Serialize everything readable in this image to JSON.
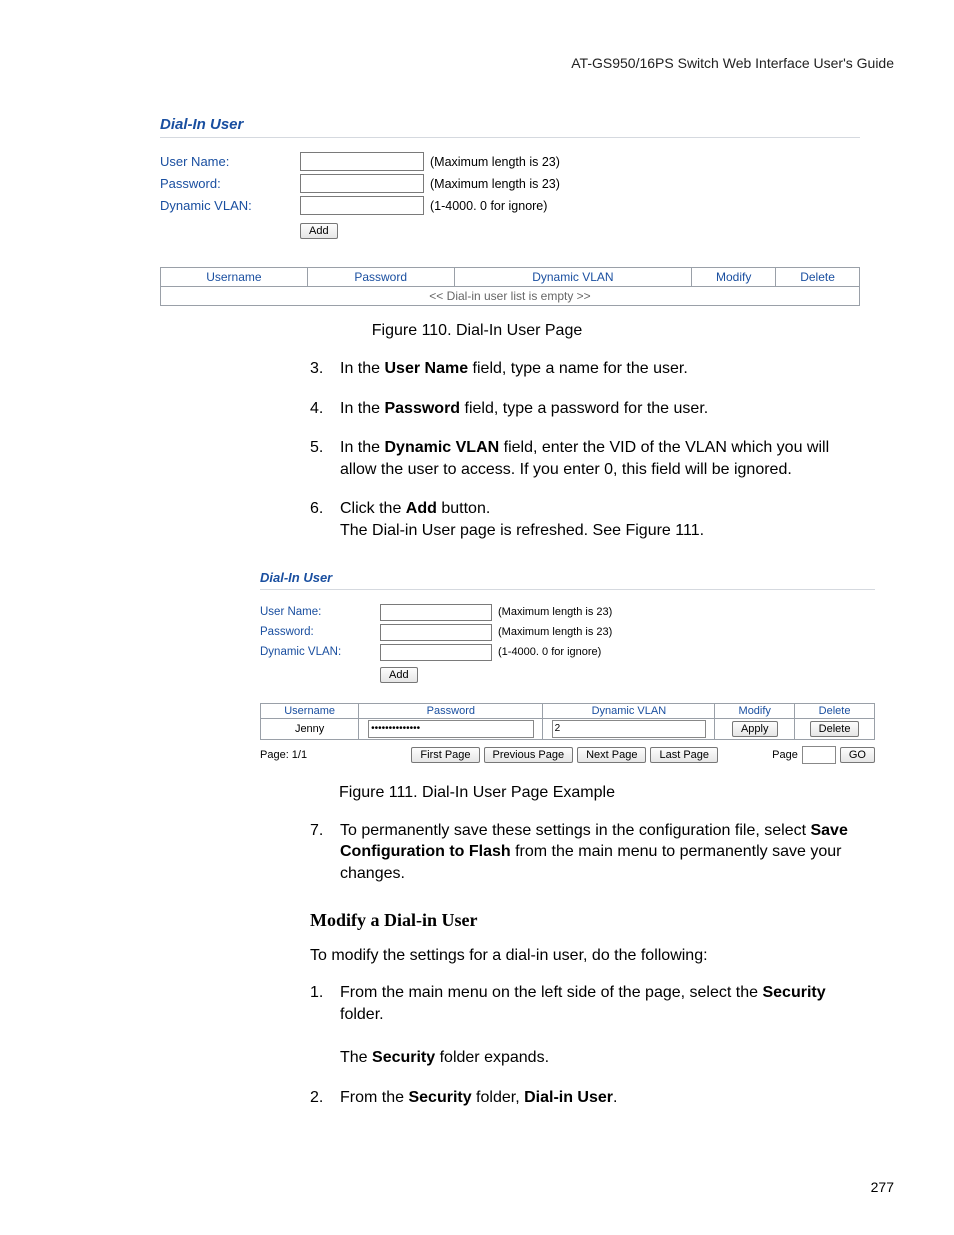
{
  "doc_header": "AT-GS950/16PS Switch Web Interface User's Guide",
  "page_number": "277",
  "fig110": {
    "title": "Dial-In User",
    "fields": {
      "username_label": "User Name:",
      "username_hint": "(Maximum length is 23)",
      "password_label": "Password:",
      "password_hint": "(Maximum length is 23)",
      "vlan_label": "Dynamic VLAN:",
      "vlan_hint": "(1-4000. 0 for ignore)"
    },
    "add_button": "Add",
    "table_headers": [
      "Username",
      "Password",
      "Dynamic VLAN",
      "Modify",
      "Delete"
    ],
    "empty_row": "<< Dial-in user list is empty >>",
    "caption": "Figure 110. Dial-In User Page"
  },
  "steps_a": {
    "n3": "3.",
    "t3_pre": "In the ",
    "t3_bold": "User Name",
    "t3_post": " field, type a name for the user.",
    "n4": "4.",
    "t4_pre": "In the ",
    "t4_bold": "Password",
    "t4_post": " field, type a password for the user.",
    "n5": "5.",
    "t5_pre": "In the ",
    "t5_bold": "Dynamic VLAN",
    "t5_post": " field, enter the VID of the VLAN which you will allow the user to access. If you enter 0, this field will be ignored.",
    "n6": "6.",
    "t6_pre": "Click the ",
    "t6_bold": "Add",
    "t6_post": " button.",
    "t6_line2": "The Dial-in User page is refreshed. See Figure 111."
  },
  "fig111": {
    "title": "Dial-In User",
    "fields": {
      "username_label": "User Name:",
      "username_hint": "(Maximum length is 23)",
      "password_label": "Password:",
      "password_hint": "(Maximum length is 23)",
      "vlan_label": "Dynamic VLAN:",
      "vlan_hint": "(1-4000. 0 for ignore)"
    },
    "add_button": "Add",
    "table_headers": [
      "Username",
      "Password",
      "Dynamic VLAN",
      "Modify",
      "Delete"
    ],
    "row": {
      "username": "Jenny",
      "password": "••••••••••••••",
      "vlan": "2",
      "modify": "Apply",
      "delete": "Delete"
    },
    "pager": {
      "info": "Page: 1/1",
      "first": "First Page",
      "prev": "Previous Page",
      "next": "Next Page",
      "last": "Last Page",
      "page_label": "Page",
      "go": "GO"
    },
    "caption": "Figure 111. Dial-In User Page Example"
  },
  "steps_b": {
    "n7": "7.",
    "t7_pre": "To permanently save these settings in the configuration file, select ",
    "t7_bold": "Save Configuration to Flash",
    "t7_post": " from the main menu to permanently save your changes."
  },
  "section": {
    "heading": "Modify a Dial-in User",
    "intro": "To modify the settings for a dial-in user, do the following:",
    "n1": "1.",
    "t1_pre": "From the main menu on the left side of the page, select the ",
    "t1_bold": "Security",
    "t1_post": " folder.",
    "t1_line2a": "The ",
    "t1_line2b": "Security",
    "t1_line2c": " folder expands.",
    "n2": "2.",
    "t2_pre": "From the ",
    "t2_bold1": "Security",
    "t2_mid": " folder, ",
    "t2_bold2": "Dial-in User",
    "t2_post": "."
  }
}
